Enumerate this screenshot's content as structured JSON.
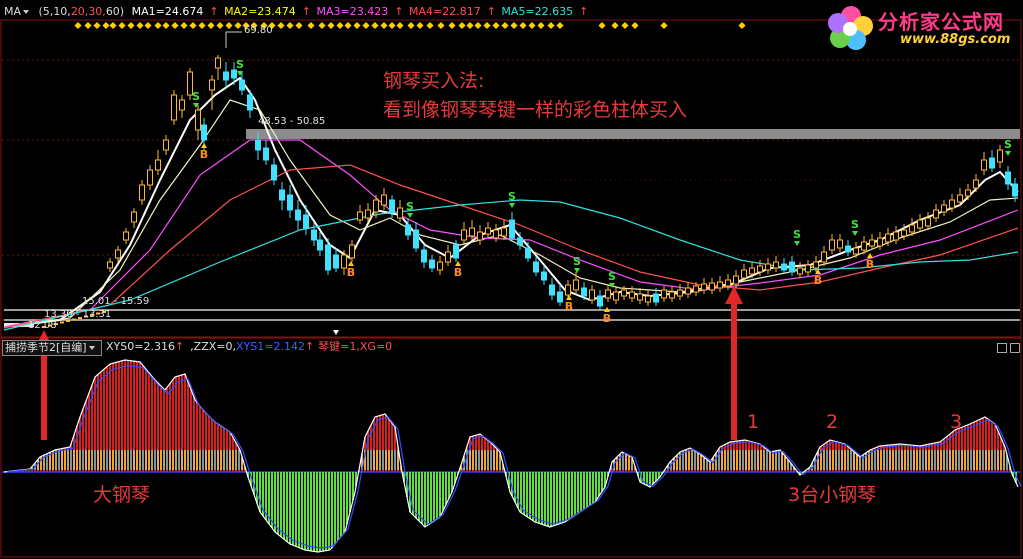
{
  "main_header": {
    "indicator": "MA",
    "params": "(5,10,20,30,60)",
    "params_parts": [
      "(5,",
      "10,",
      "20,",
      "30,",
      "60)"
    ],
    "ma1": "MA1=24.674",
    "ma2": "MA2=23.474",
    "ma3": "MA3=23.423",
    "ma4": "MA4=22.817",
    "ma5": "MA5=22.635",
    "colors": {
      "ma1": "#ffffff",
      "ma2": "#ffff00",
      "ma3": "#ff50ff",
      "ma4": "#ff5050",
      "ma5": "#30e0e0"
    }
  },
  "price_labels": {
    "high": "69.80",
    "band": "48.53 - 50.85",
    "low_band": "15.01 - 15.59",
    "low2": "13.30 - 13.31",
    "low3": "12.08"
  },
  "annotations": {
    "title_line1": "钢琴买入法:",
    "title_line2": "看到像钢琴琴键一样的彩色柱体买入",
    "big_piano": "大钢琴",
    "small_pianos": "3台小钢琴",
    "num1": "1",
    "num2": "2",
    "num3": "3"
  },
  "signals": {
    "buy": "B",
    "sell": "S"
  },
  "sub_header": {
    "title": "捕捞季节2[自编]",
    "xys0": "XYS0=2.316",
    "zzx": ",ZZX=0,",
    "xys1": "XYS1=2.142",
    "piano_key": "琴键=1,XG=0"
  },
  "logo": {
    "name": "分析家公式网",
    "url": "www.88gs.com"
  },
  "colors": {
    "up": "#ffb830",
    "down": "#40e0ff",
    "red_bar": "#d81e1e",
    "green_bar": "#60e03a",
    "annotation": "#e83a3a"
  }
}
